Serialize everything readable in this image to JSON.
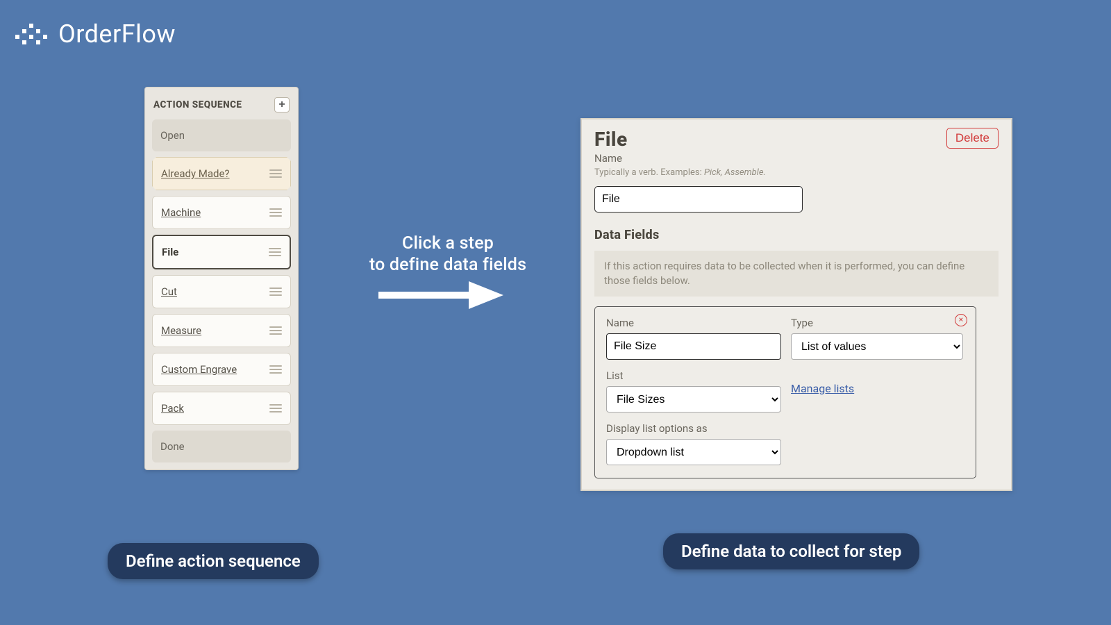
{
  "brand": {
    "name": "OrderFlow"
  },
  "sequence_panel": {
    "title": "ACTION SEQUENCE",
    "add_label": "+",
    "steps": [
      {
        "label": "Open",
        "kind": "terminal"
      },
      {
        "label": "Already Made?",
        "kind": "branch"
      },
      {
        "label": "Machine",
        "kind": "normal"
      },
      {
        "label": "File",
        "kind": "selected"
      },
      {
        "label": "Cut",
        "kind": "normal"
      },
      {
        "label": "Measure",
        "kind": "normal"
      },
      {
        "label": "Custom Engrave",
        "kind": "normal"
      },
      {
        "label": "Pack",
        "kind": "normal"
      },
      {
        "label": "Done",
        "kind": "terminal"
      }
    ]
  },
  "callouts": {
    "mid_line1": "Click a step",
    "mid_line2": "to define data fields",
    "pill_left": "Define action sequence",
    "pill_right": "Define data to collect for step"
  },
  "detail_panel": {
    "title": "File",
    "delete_label": "Delete",
    "name_label": "Name",
    "name_help_prefix": "Typically a verb. Examples: ",
    "name_help_examples": "Pick, Assemble.",
    "name_value": "File",
    "data_fields_heading": "Data Fields",
    "info_text": "If this action requires data to be collected when it is performed, you can define those fields below.",
    "field": {
      "name_label": "Name",
      "name_value": "File Size",
      "type_label": "Type",
      "type_value": "List of values",
      "list_label": "List",
      "list_value": "File Sizes",
      "manage_lists": "Manage lists",
      "display_label": "Display list options as",
      "display_value": "Dropdown list",
      "remove_label": "×"
    }
  }
}
